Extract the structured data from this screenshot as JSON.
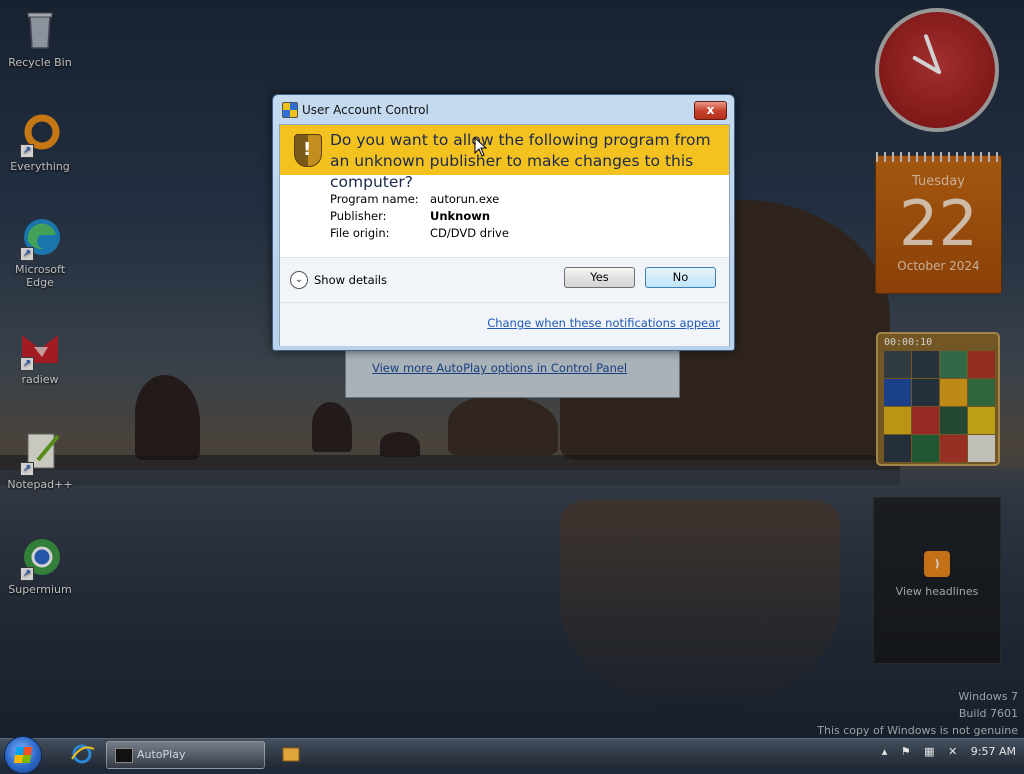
{
  "desktop": {
    "icons": [
      {
        "label": "Recycle Bin",
        "icon": "recycle-bin-icon"
      },
      {
        "label": "Everything",
        "icon": "everything-icon"
      },
      {
        "label": "Microsoft Edge",
        "icon": "edge-icon"
      },
      {
        "label": "radiew",
        "icon": "radiew-icon"
      },
      {
        "label": "Notepad++",
        "icon": "notepadpp-icon"
      },
      {
        "label": "Supermium",
        "icon": "supermium-icon"
      }
    ]
  },
  "gadgets": {
    "calendar": {
      "weekday": "Tuesday",
      "day": "22",
      "month": "October 2024"
    },
    "puzzle": {
      "timer": "00:00:10"
    },
    "feed": {
      "label": "View headlines"
    }
  },
  "watermark": {
    "line1": "Windows 7",
    "line2": "Build 7601",
    "line3": "This copy of Windows is not genuine"
  },
  "autoplay": {
    "link": "View more AutoPlay options in Control Panel"
  },
  "uac": {
    "title": "User Account Control",
    "close_label": "x",
    "question": "Do you want to allow the following program from an unknown publisher to make changes to this computer?",
    "details": {
      "program_name_label": "Program name:",
      "program_name": "autorun.exe",
      "publisher_label": "Publisher:",
      "publisher": "Unknown",
      "file_origin_label": "File origin:",
      "file_origin": "CD/DVD drive"
    },
    "show_details": "Show details",
    "yes_label": "Yes",
    "no_label": "No",
    "change_link": "Change when these notifications appear"
  },
  "taskbar": {
    "task_label": "AutoPlay",
    "clock": "9:57 AM"
  },
  "colors": {
    "banner": "#f4c21e",
    "link": "#1f5ab8",
    "calendar": "#c86b14",
    "clock_face": "#c53a3a"
  }
}
